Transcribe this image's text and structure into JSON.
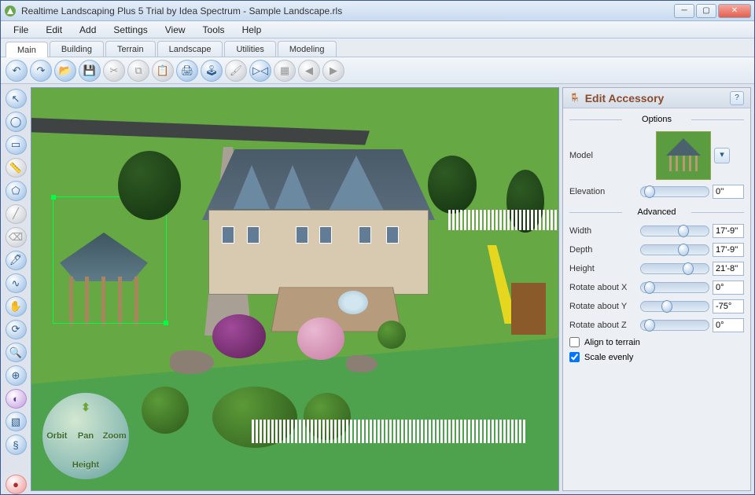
{
  "window": {
    "title": "Realtime Landscaping Plus 5 Trial by Idea Spectrum - Sample Landscape.rls"
  },
  "menu": [
    "File",
    "Edit",
    "Add",
    "Settings",
    "View",
    "Tools",
    "Help"
  ],
  "tabs": [
    "Main",
    "Building",
    "Terrain",
    "Landscape",
    "Utilities",
    "Modeling"
  ],
  "active_tab": 0,
  "toolbar_icons": [
    "undo",
    "redo",
    "open",
    "save",
    "cut",
    "copy",
    "paste",
    "print",
    "joystick",
    "paint",
    "mirror",
    "grid",
    "left",
    "right"
  ],
  "toolbar_disabled": [
    4,
    5,
    6,
    9,
    11,
    12,
    13
  ],
  "sidebar_icons": [
    "pointer",
    "circle",
    "rectangle",
    "ruler",
    "shape",
    "line",
    "erase",
    "brush",
    "curve",
    "hand",
    "rotate",
    "zoom",
    "target",
    "color",
    "material",
    "snake",
    "spacer",
    "record"
  ],
  "sidebar_disabled": [
    3,
    5,
    6
  ],
  "compass": {
    "orbit": "Orbit",
    "zoom": "Zoom",
    "pan": "Pan",
    "height": "Height"
  },
  "panel": {
    "title": "Edit Accessory",
    "sections": {
      "options": "Options",
      "advanced": "Advanced"
    },
    "model_label": "Model",
    "rows": [
      {
        "label": "Elevation",
        "value": "0''",
        "thumb": 5
      },
      {
        "label": "Width",
        "value": "17'-9''",
        "thumb": 55
      },
      {
        "label": "Depth",
        "value": "17'-9''",
        "thumb": 55
      },
      {
        "label": "Height",
        "value": "21'-8''",
        "thumb": 62
      },
      {
        "label": "Rotate about X",
        "value": "0°",
        "thumb": 5
      },
      {
        "label": "Rotate about Y",
        "value": "-75°",
        "thumb": 30
      },
      {
        "label": "Rotate about Z",
        "value": "0°",
        "thumb": 5
      }
    ],
    "checks": {
      "align_to_terrain": {
        "label": "Align to terrain",
        "checked": false
      },
      "scale_evenly": {
        "label": "Scale evenly",
        "checked": true
      }
    }
  }
}
